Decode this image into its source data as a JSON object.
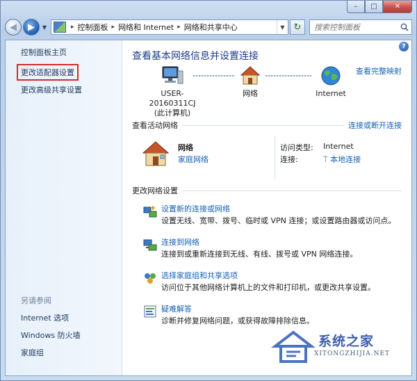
{
  "breadcrumb": [
    "控制面板",
    "网络和 Internet",
    "网络和共享中心"
  ],
  "search": {
    "placeholder": "搜索控制面板"
  },
  "caption": {
    "minimize": "–",
    "maximize": "□",
    "close": "✕"
  },
  "sidebar": {
    "items": [
      "控制面板主页",
      "更改适配器设置",
      "更改高级共享设置"
    ],
    "see_also_title": "另请参阅",
    "see_also": [
      "Internet 选项",
      "Windows 防火墙",
      "家庭组"
    ]
  },
  "main": {
    "heading": "查看基本网络信息并设置连接",
    "full_map": "查看完整映射",
    "map_nodes": [
      {
        "label": "USER-20160311CJ",
        "sublabel": "(此计算机)"
      },
      {
        "label": "网络",
        "sublabel": ""
      },
      {
        "label": "Internet",
        "sublabel": ""
      }
    ],
    "active_title": "查看活动网络",
    "connect_disconnect": "连接或断开连接",
    "active_network": {
      "name": "网络",
      "type": "家庭网络",
      "access_label": "访问类型:",
      "access_value": "Internet",
      "connection_label": "连接:",
      "connection_value": "本地连接"
    },
    "change_title": "更改网络设置",
    "tasks": [
      {
        "link": "设置新的连接或网络",
        "desc": "设置无线、宽带、拨号、临时或 VPN 连接；或设置路由器或访问点。"
      },
      {
        "link": "连接到网络",
        "desc": "连接到或重新连接到无线、有线、拨号或 VPN 网络连接。"
      },
      {
        "link": "选择家庭组和共享选项",
        "desc": "访问位于其他网络计算机上的文件和打印机，或更改共享设置。"
      },
      {
        "link": "疑难解答",
        "desc": "诊断并修复网络问题，或获得故障排除信息。"
      }
    ]
  },
  "watermark": {
    "title": "系统之家",
    "url": "XITONGZHIJIA.NET"
  },
  "colors": {
    "link": "#1561b8",
    "heading": "#1e3e8a",
    "highlight_box": "#d72a2a"
  }
}
